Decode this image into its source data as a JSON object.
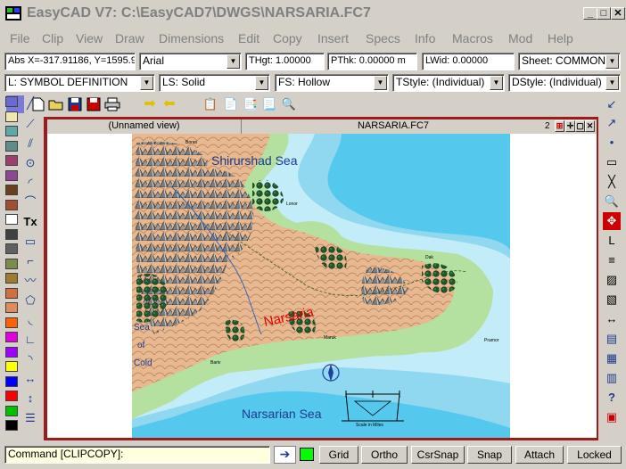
{
  "window": {
    "title": "EasyCAD V7: C:\\EasyCAD7\\DWGS\\NARSARIA.FC7",
    "min_label": "_",
    "max_label": "□",
    "close_label": "✕"
  },
  "menu": [
    "File",
    "Clip",
    "View",
    "Draw",
    "Dimensions",
    "Edit",
    "Copy",
    "Insert",
    "Specs",
    "Info",
    "Macros",
    "Mod",
    "Help"
  ],
  "props_row1": {
    "coords": "Abs X=-317.91186, Y=1595.9",
    "font": "Arial",
    "thgt": "THgt: 1.00000",
    "pthk": "PThk: 0.00000 m",
    "lwid": "LWid: 0.00000",
    "sheet": "Sheet: COMMON"
  },
  "props_row2": {
    "layer": "L: SYMBOL DEFINITION",
    "linestyle": "LS: Solid",
    "fillstyle": "FS: Hollow",
    "tstyle": "TStyle: (Individual)",
    "dstyle": "DStyle: (Individual)"
  },
  "drawing": {
    "view_tab": "(Unnamed view)",
    "file_tab": "NARSARIA.FC7",
    "view_count": "2"
  },
  "map": {
    "north_sea": "Shirurshad Sea",
    "south_sea": "Narsarian Sea",
    "west_sea": [
      "Sea",
      "of",
      "Cold"
    ],
    "region": "Narsaria",
    "town_labels": [
      "Boran",
      "Lonor",
      "Bariv",
      "Dak",
      "Pramor",
      "Maruk"
    ],
    "scale_label": "Scale in Miles",
    "colors": {
      "deep_sea": "#55c8ee",
      "mid_sea": "#8fd8f0",
      "shallow_sea": "#c2ecf8",
      "lowland": "#b4e0a0",
      "highland": "#e8b890",
      "mountain": "#8c8c8c",
      "forest": "#1e5a2a"
    }
  },
  "status": {
    "command": "Command [CLIPCOPY]:",
    "buttons": [
      "Grid",
      "Ortho",
      "CsrSnap",
      "Snap",
      "Attach",
      "Locked"
    ]
  },
  "palette_colors": [
    "#6a6ad6",
    "#f2e6b0",
    "#60a8a8",
    "#608c8c",
    "#a03c70",
    "#8c4890",
    "#6a4020",
    "#a05030",
    "#ffffff",
    "#404040",
    "#606060",
    "#7c8c4c",
    "#a07a30",
    "#d07040",
    "#e08a60",
    "#ff6000",
    "#e000e0",
    "#a000ff",
    "#ffff00",
    "#0000ff",
    "#ff0000",
    "#00c000",
    "#000000"
  ],
  "left_tools": [
    "line-icon",
    "polyline-icon",
    "parallel-lines-icon",
    "circle-icon",
    "arc-icon",
    "curve-icon",
    "text-icon",
    "rectangle-icon",
    "angled-arc-icon",
    "freehand-icon",
    "polygon-icon",
    "fillet-icon",
    "chamfer-icon",
    "ellipse-arc-icon",
    "corner-icon",
    "dimension-icon",
    "vertical-dim-icon",
    "list-icon"
  ],
  "right_tools": [
    "arrow-down-left-icon",
    "arrow-up-right-icon",
    "dot-icon",
    "rect-outline-icon",
    "cross-icon",
    "zoom-icon",
    "target-icon",
    "angle-icon",
    "lines-icon",
    "hatch-icon",
    "hatch2-icon",
    "hatch3-icon",
    "dim-arrows-icon",
    "table-icon",
    "grid-icon",
    "help-icon",
    "redraw-icon"
  ]
}
